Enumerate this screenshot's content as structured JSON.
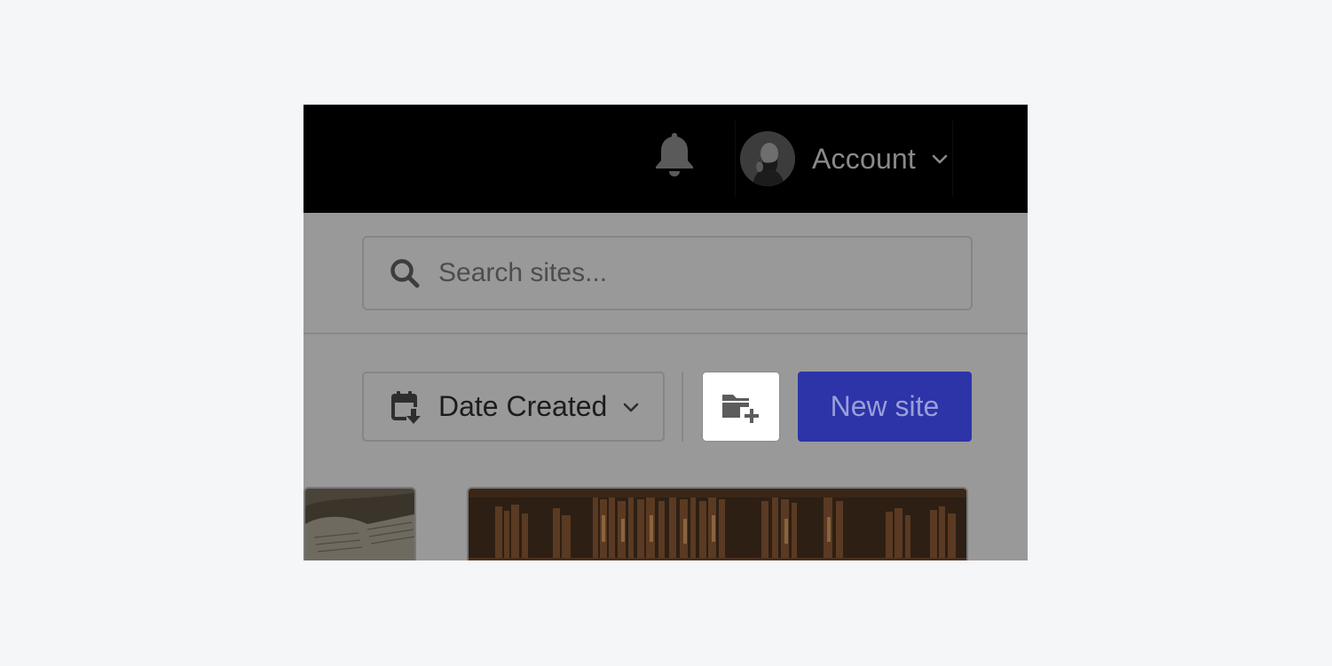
{
  "topbar": {
    "notifications_icon": "bell-icon",
    "account": {
      "label": "Account",
      "avatar_icon": "user-avatar",
      "chevron_icon": "chevron-down-icon"
    }
  },
  "search": {
    "placeholder": "Search sites...",
    "value": "",
    "icon": "search-icon"
  },
  "toolbar": {
    "sort": {
      "label": "Date Created",
      "icon": "calendar-sort-icon",
      "chevron_icon": "chevron-down-icon"
    },
    "new_folder_icon": "folder-plus-icon",
    "new_site_label": "New site"
  },
  "sites": [
    {
      "thumbnail": "open-book-photo"
    },
    {
      "thumbnail": "bookshelf-photo"
    }
  ],
  "colors": {
    "page_background": "#f5f6f8",
    "topbar": "#000000",
    "overlay": "#999999",
    "primary_button": "#2c34a8"
  }
}
